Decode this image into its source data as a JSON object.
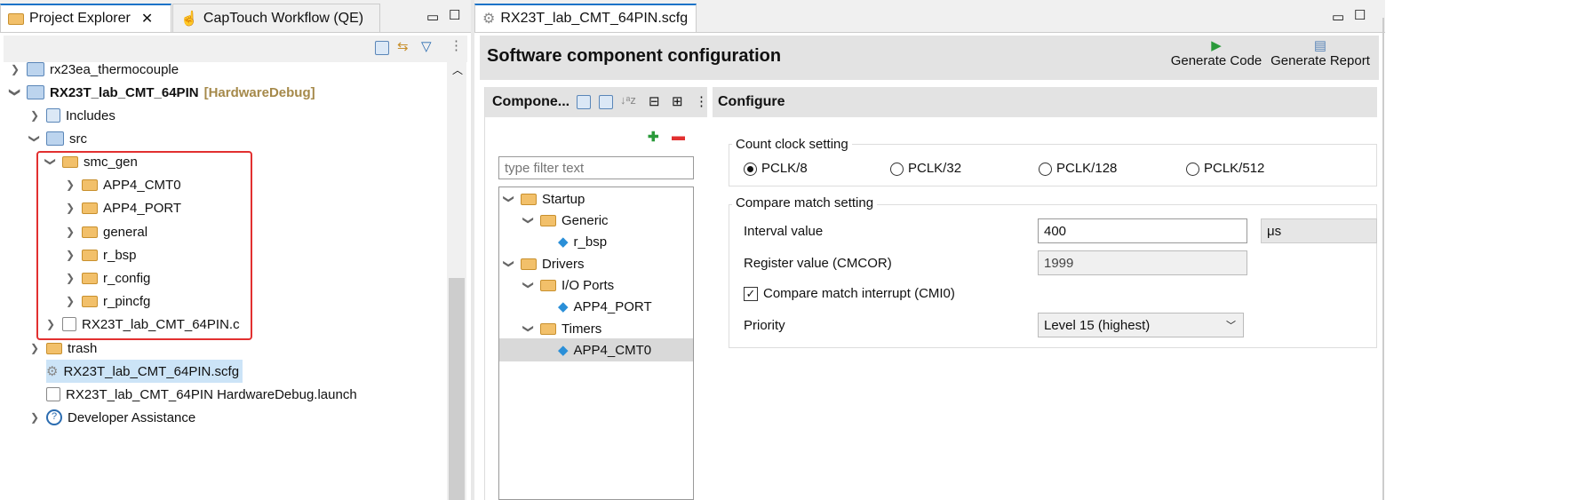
{
  "left": {
    "tabs": [
      {
        "label": "Project Explorer"
      },
      {
        "label": "CapTouch Workflow (QE)"
      }
    ],
    "tree": [
      {
        "label": "rx23ea_thermocouple",
        "suffix": ""
      },
      {
        "label": "RX23T_lab_CMT_64PIN",
        "suffix": "[HardwareDebug]"
      },
      {
        "label": "Includes"
      },
      {
        "label": "src"
      },
      {
        "label": "smc_gen"
      },
      {
        "label": "APP4_CMT0"
      },
      {
        "label": "APP4_PORT"
      },
      {
        "label": "general"
      },
      {
        "label": "r_bsp"
      },
      {
        "label": "r_config"
      },
      {
        "label": "r_pincfg"
      },
      {
        "label": "RX23T_lab_CMT_64PIN.c"
      },
      {
        "label": "trash"
      },
      {
        "label": "RX23T_lab_CMT_64PIN.scfg"
      },
      {
        "label": "RX23T_lab_CMT_64PIN HardwareDebug.launch"
      },
      {
        "label": "Developer Assistance"
      }
    ]
  },
  "editor": {
    "tab": "RX23T_lab_CMT_64PIN.scfg",
    "title": "Software component configuration",
    "generate_code": "Generate Code",
    "generate_report": "Generate Report",
    "components": {
      "title": "Compone...",
      "filter_placeholder": "type filter text",
      "tree": [
        {
          "label": "Startup"
        },
        {
          "label": "Generic"
        },
        {
          "label": "r_bsp"
        },
        {
          "label": "Drivers"
        },
        {
          "label": "I/O Ports"
        },
        {
          "label": "APP4_PORT"
        },
        {
          "label": "Timers"
        },
        {
          "label": "APP4_CMT0"
        }
      ]
    },
    "configure": {
      "title": "Configure",
      "count_clock": "Count clock setting",
      "radios": [
        {
          "label": "PCLK/8",
          "checked": true
        },
        {
          "label": "PCLK/32"
        },
        {
          "label": "PCLK/128"
        },
        {
          "label": "PCLK/512"
        }
      ],
      "compare_match": "Compare match setting",
      "interval_label": "Interval value",
      "interval_value": "400",
      "unit": "μs",
      "register_label": "Register value (CMCOR)",
      "register_value": "1999",
      "interrupt_label": "Compare match interrupt (CMI0)",
      "interrupt_checked": true,
      "priority_label": "Priority",
      "priority_value": "Level 15 (highest)"
    }
  }
}
